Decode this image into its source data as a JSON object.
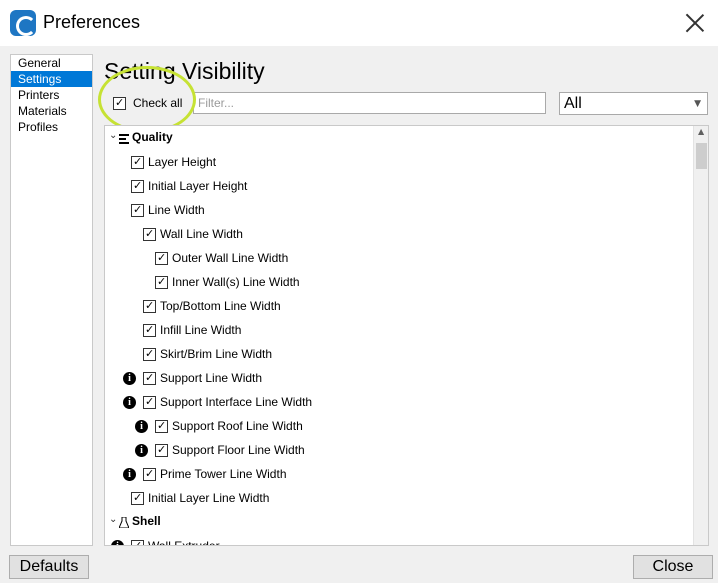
{
  "window": {
    "title": "Preferences"
  },
  "nav": {
    "items": [
      {
        "label": "General",
        "selected": false
      },
      {
        "label": "Settings",
        "selected": true
      },
      {
        "label": "Printers",
        "selected": false
      },
      {
        "label": "Materials",
        "selected": false
      },
      {
        "label": "Profiles",
        "selected": false
      }
    ]
  },
  "page": {
    "title": "Setting Visibility",
    "check_all": {
      "label": "Check all",
      "checked": true
    },
    "filter": {
      "placeholder": "Filter...",
      "value": ""
    },
    "visibility_select": {
      "value": "All"
    }
  },
  "settings_list": {
    "rows": [
      {
        "type": "category",
        "label": "Quality",
        "icon": "quality-icon",
        "expanded": true
      },
      {
        "type": "setting",
        "label": "Layer Height",
        "checked": true,
        "depth": 0,
        "info": false
      },
      {
        "type": "setting",
        "label": "Initial Layer Height",
        "checked": true,
        "depth": 0,
        "info": false
      },
      {
        "type": "setting",
        "label": "Line Width",
        "checked": true,
        "depth": 0,
        "info": false
      },
      {
        "type": "setting",
        "label": "Wall Line Width",
        "checked": true,
        "depth": 1,
        "info": false
      },
      {
        "type": "setting",
        "label": "Outer Wall Line Width",
        "checked": true,
        "depth": 2,
        "info": false
      },
      {
        "type": "setting",
        "label": "Inner Wall(s) Line Width",
        "checked": true,
        "depth": 2,
        "info": false
      },
      {
        "type": "setting",
        "label": "Top/Bottom Line Width",
        "checked": true,
        "depth": 1,
        "info": false
      },
      {
        "type": "setting",
        "label": "Infill Line Width",
        "checked": true,
        "depth": 1,
        "info": false
      },
      {
        "type": "setting",
        "label": "Skirt/Brim Line Width",
        "checked": true,
        "depth": 1,
        "info": false
      },
      {
        "type": "setting",
        "label": "Support Line Width",
        "checked": true,
        "depth": 1,
        "info": true
      },
      {
        "type": "setting",
        "label": "Support Interface Line Width",
        "checked": true,
        "depth": 1,
        "info": true
      },
      {
        "type": "setting",
        "label": "Support Roof Line Width",
        "checked": true,
        "depth": 2,
        "info": true
      },
      {
        "type": "setting",
        "label": "Support Floor Line Width",
        "checked": true,
        "depth": 2,
        "info": true
      },
      {
        "type": "setting",
        "label": "Prime Tower Line Width",
        "checked": true,
        "depth": 1,
        "info": true
      },
      {
        "type": "setting",
        "label": "Initial Layer Line Width",
        "checked": true,
        "depth": 0,
        "info": false
      },
      {
        "type": "category",
        "label": "Shell",
        "icon": "shell-icon",
        "expanded": true
      },
      {
        "type": "setting",
        "label": "Wall Extruder",
        "checked": true,
        "depth": 0,
        "info": true
      }
    ]
  },
  "footer": {
    "defaults_label": "Defaults",
    "close_label": "Close"
  },
  "colors": {
    "accent": "#0078d7",
    "highlight_ring": "#c6e234",
    "app_icon": "#1e76c3"
  }
}
